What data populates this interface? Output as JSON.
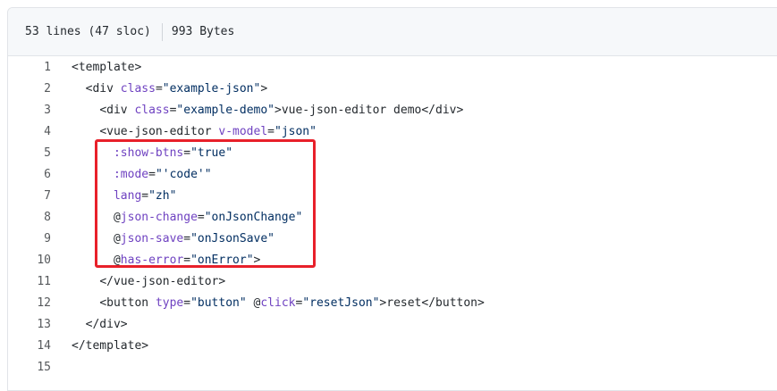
{
  "file_header": {
    "lines_info": "53 lines (47 sloc)",
    "size_info": "993 Bytes"
  },
  "code_lines": [
    {
      "num": "1",
      "indent": "",
      "tokens": [
        [
          "p",
          "<template>"
        ]
      ]
    },
    {
      "num": "2",
      "indent": "  ",
      "tokens": [
        [
          "p",
          "<div "
        ],
        [
          "a",
          "class"
        ],
        [
          "p",
          "="
        ],
        [
          "s",
          "\"example-json\""
        ],
        [
          "p",
          ">"
        ]
      ]
    },
    {
      "num": "3",
      "indent": "    ",
      "tokens": [
        [
          "p",
          "<div "
        ],
        [
          "a",
          "class"
        ],
        [
          "p",
          "="
        ],
        [
          "s",
          "\"example-demo\""
        ],
        [
          "p",
          ">vue-json-editor demo</div>"
        ]
      ]
    },
    {
      "num": "4",
      "indent": "    ",
      "tokens": [
        [
          "p",
          "<vue-json-editor "
        ],
        [
          "a",
          "v-model"
        ],
        [
          "p",
          "="
        ],
        [
          "s",
          "\"json\""
        ]
      ]
    },
    {
      "num": "5",
      "indent": "      ",
      "tokens": [
        [
          "a",
          ":show-btns"
        ],
        [
          "p",
          "="
        ],
        [
          "s",
          "\"true\""
        ]
      ]
    },
    {
      "num": "6",
      "indent": "      ",
      "tokens": [
        [
          "a",
          ":mode"
        ],
        [
          "p",
          "="
        ],
        [
          "s",
          "\"'code'\""
        ]
      ]
    },
    {
      "num": "7",
      "indent": "      ",
      "tokens": [
        [
          "a",
          "lang"
        ],
        [
          "p",
          "="
        ],
        [
          "s",
          "\"zh\""
        ]
      ]
    },
    {
      "num": "8",
      "indent": "      ",
      "tokens": [
        [
          "p",
          "@"
        ],
        [
          "a",
          "json-change"
        ],
        [
          "p",
          "="
        ],
        [
          "s",
          "\"onJsonChange\""
        ]
      ]
    },
    {
      "num": "9",
      "indent": "      ",
      "tokens": [
        [
          "p",
          "@"
        ],
        [
          "a",
          "json-save"
        ],
        [
          "p",
          "="
        ],
        [
          "s",
          "\"onJsonSave\""
        ]
      ]
    },
    {
      "num": "10",
      "indent": "      ",
      "tokens": [
        [
          "p",
          "@"
        ],
        [
          "a",
          "has-error"
        ],
        [
          "p",
          "="
        ],
        [
          "s",
          "\"onError\""
        ],
        [
          "p",
          ">"
        ]
      ]
    },
    {
      "num": "11",
      "indent": "    ",
      "tokens": [
        [
          "p",
          "</vue-json-editor>"
        ]
      ]
    },
    {
      "num": "12",
      "indent": "    ",
      "tokens": [
        [
          "p",
          "<button "
        ],
        [
          "a",
          "type"
        ],
        [
          "p",
          "="
        ],
        [
          "s",
          "\"button\""
        ],
        [
          "p",
          " @"
        ],
        [
          "a",
          "click"
        ],
        [
          "p",
          "="
        ],
        [
          "s",
          "\"resetJson\""
        ],
        [
          "p",
          ">reset</button>"
        ]
      ]
    },
    {
      "num": "13",
      "indent": "  ",
      "tokens": [
        [
          "p",
          "</div>"
        ]
      ]
    },
    {
      "num": "14",
      "indent": "",
      "tokens": [
        [
          "p",
          "</template>"
        ]
      ]
    },
    {
      "num": "15",
      "indent": "",
      "tokens": []
    }
  ],
  "colors": {
    "attribute": "#6f42c1",
    "string": "#032f62",
    "plain": "#24292e",
    "highlight_border": "#e8202a"
  }
}
